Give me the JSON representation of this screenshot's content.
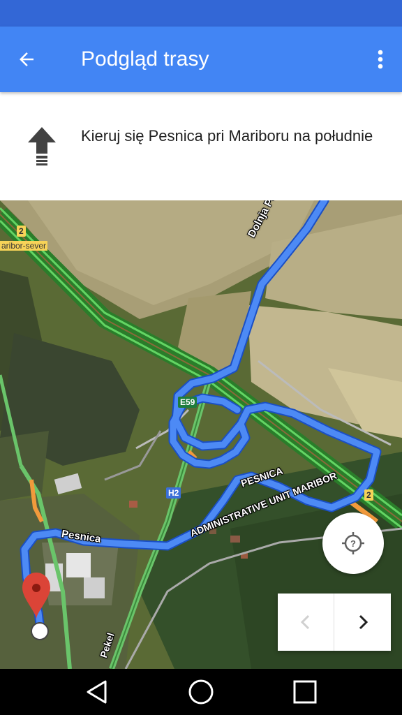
{
  "app_bar": {
    "title": "Podgląd trasy",
    "back_icon": "arrow-left-icon",
    "menu_icon": "more-vert-icon",
    "color": "#4285f4",
    "status_bar_color": "#3367d6"
  },
  "instruction": {
    "icon": "straight-arrow-icon",
    "text": "Kieruj się Pesnica pri Mariboru na południe"
  },
  "map": {
    "route_color": "#4285f4",
    "labels": {
      "dolnja": "Dolnja Počehova",
      "pesnica_road": "Pesnica",
      "pesnica_area": "PESNICA",
      "admin_unit": "ADMINISTRATIVE UNIT MARIBOR",
      "pekel": "Pekel",
      "maribor_sever": "aribor-sever"
    },
    "shields": {
      "e59": "E59",
      "h2": "H2",
      "route2_top": "2",
      "route2_right": "2"
    },
    "pin_color": "#db4437"
  },
  "controls": {
    "locate_icon": "my-location-icon",
    "prev_icon": "chevron-left-icon",
    "next_icon": "chevron-right-icon"
  },
  "system_nav": {
    "back_icon": "triangle-back-icon",
    "home_icon": "circle-home-icon",
    "recents_icon": "square-recents-icon"
  }
}
